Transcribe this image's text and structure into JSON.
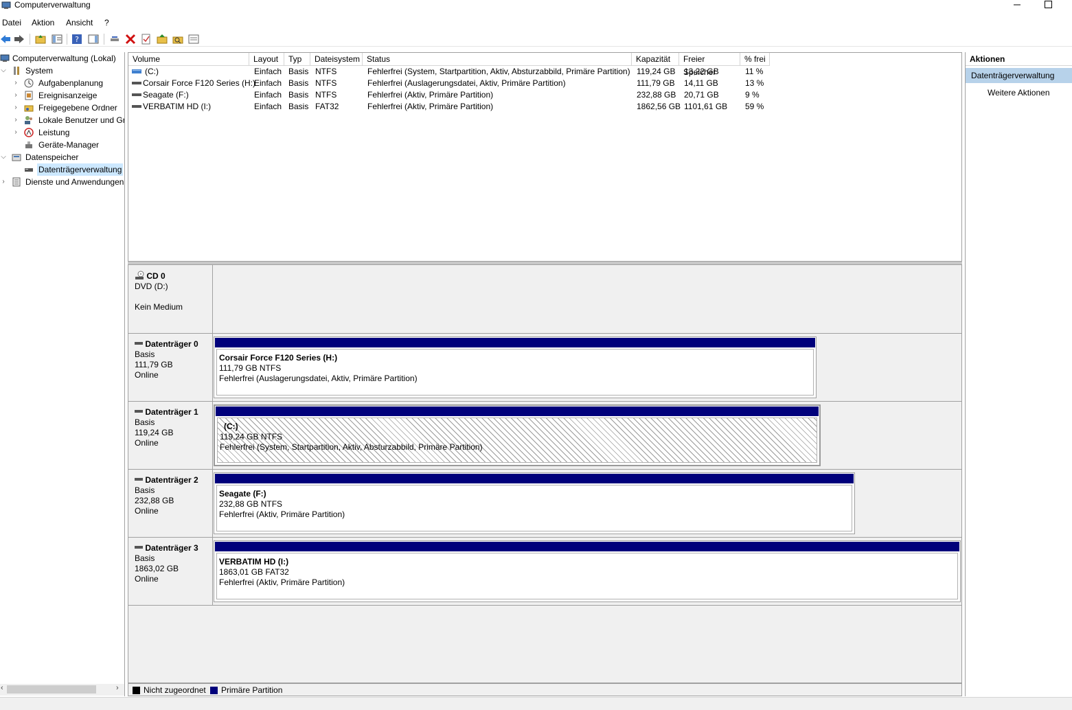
{
  "window": {
    "title": "Computerverwaltung"
  },
  "menu": [
    "Datei",
    "Aktion",
    "Ansicht",
    "?"
  ],
  "tree": {
    "root": "Computerverwaltung (Lokal)",
    "system": "System",
    "aufgaben": "Aufgabenplanung",
    "ereignis": "Ereignisanzeige",
    "freigaben": "Freigegebene Ordner",
    "benutzer": "Lokale Benutzer und Gr",
    "leistung": "Leistung",
    "geraete": "Geräte-Manager",
    "datenspeicher": "Datenspeicher",
    "dtv": "Datenträgerverwaltung",
    "dienste": "Dienste und Anwendungen"
  },
  "table": {
    "headers": [
      "Volume",
      "Layout",
      "Typ",
      "Dateisystem",
      "Status",
      "Kapazität",
      "Freier Speicher",
      "% frei"
    ],
    "rows": [
      [
        "(C:)",
        "Einfach",
        "Basis",
        "NTFS",
        "Fehlerfrei (System, Startpartition, Aktiv, Absturzabbild, Primäre Partition)",
        "119,24 GB",
        "13,22 GB",
        "11 %"
      ],
      [
        "Corsair Force F120 Series (H:)",
        "Einfach",
        "Basis",
        "NTFS",
        "Fehlerfrei (Auslagerungsdatei, Aktiv, Primäre Partition)",
        "111,79 GB",
        "14,11 GB",
        "13 %"
      ],
      [
        "Seagate (F:)",
        "Einfach",
        "Basis",
        "NTFS",
        "Fehlerfrei (Aktiv, Primäre Partition)",
        "232,88 GB",
        "20,71 GB",
        "9 %"
      ],
      [
        "VERBATIM HD (I:)",
        "Einfach",
        "Basis",
        "FAT32",
        "Fehlerfrei (Aktiv, Primäre Partition)",
        "1862,56 GB",
        "1101,61 GB",
        "59 %"
      ]
    ]
  },
  "disks": {
    "cd0": {
      "name": "CD 0",
      "line1": "DVD (D:)",
      "line2": "Kein Medium"
    },
    "d0": {
      "name": "Datenträger 0",
      "type": "Basis",
      "size": "111,79 GB",
      "state": "Online",
      "part_name": "Corsair Force F120 Series  (H:)",
      "part_fs": "111,79 GB NTFS",
      "part_status": "Fehlerfrei (Auslagerungsdatei, Aktiv, Primäre Partition)"
    },
    "d1": {
      "name": "Datenträger 1",
      "type": "Basis",
      "size": "119,24 GB",
      "state": "Online",
      "part_name": "(C:)",
      "part_fs": "119,24 GB NTFS",
      "part_status": "Fehlerfrei (System, Startpartition, Aktiv, Absturzabbild, Primäre Partition)"
    },
    "d2": {
      "name": "Datenträger 2",
      "type": "Basis",
      "size": "232,88 GB",
      "state": "Online",
      "part_name": "Seagate  (F:)",
      "part_fs": "232,88 GB NTFS",
      "part_status": "Fehlerfrei (Aktiv, Primäre Partition)"
    },
    "d3": {
      "name": "Datenträger 3",
      "type": "Basis",
      "size": "1863,02 GB",
      "state": "Online",
      "part_name": "VERBATIM HD  (I:)",
      "part_fs": "1863,01 GB FAT32",
      "part_status": "Fehlerfrei (Aktiv, Primäre Partition)"
    }
  },
  "legend": {
    "unallocated": "Nicht zugeordnet",
    "primary": "Primäre Partition",
    "unallocated_color": "#000000",
    "primary_color": "#00007b"
  },
  "actions": {
    "header": "Aktionen",
    "section": "Datenträgerverwaltung",
    "more": "Weitere Aktionen"
  }
}
